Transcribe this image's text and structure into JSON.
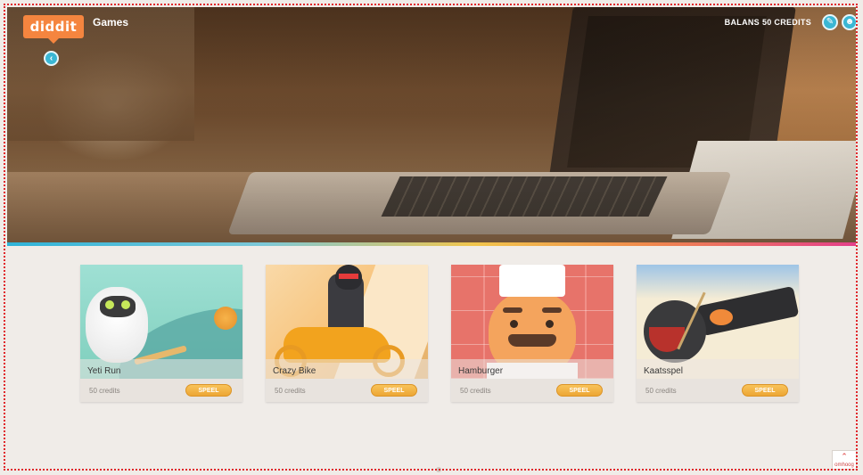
{
  "header": {
    "logo_text": "diddit",
    "section_title": "Games",
    "balance_label": "BALANS",
    "balance_value": "50 CREDITS",
    "icons": [
      "back-arrow-icon",
      "edit-icon",
      "profile-icon"
    ]
  },
  "games": [
    {
      "name": "Yeti Run",
      "price": "50 credits",
      "button": "SPEEL"
    },
    {
      "name": "Crazy Bike",
      "price": "50 credits",
      "button": "SPEEL"
    },
    {
      "name": "Hamburger",
      "price": "50 credits",
      "button": "SPEEL"
    },
    {
      "name": "Kaatsspel",
      "price": "50 credits",
      "button": "SPEEL"
    }
  ],
  "scroll_top": {
    "label": "omhoog"
  },
  "colors": {
    "accent_orange": "#f5853f",
    "accent_blue": "#3bb7d4",
    "button_yellow": "#f8c35a",
    "background": "#f0ece8"
  }
}
